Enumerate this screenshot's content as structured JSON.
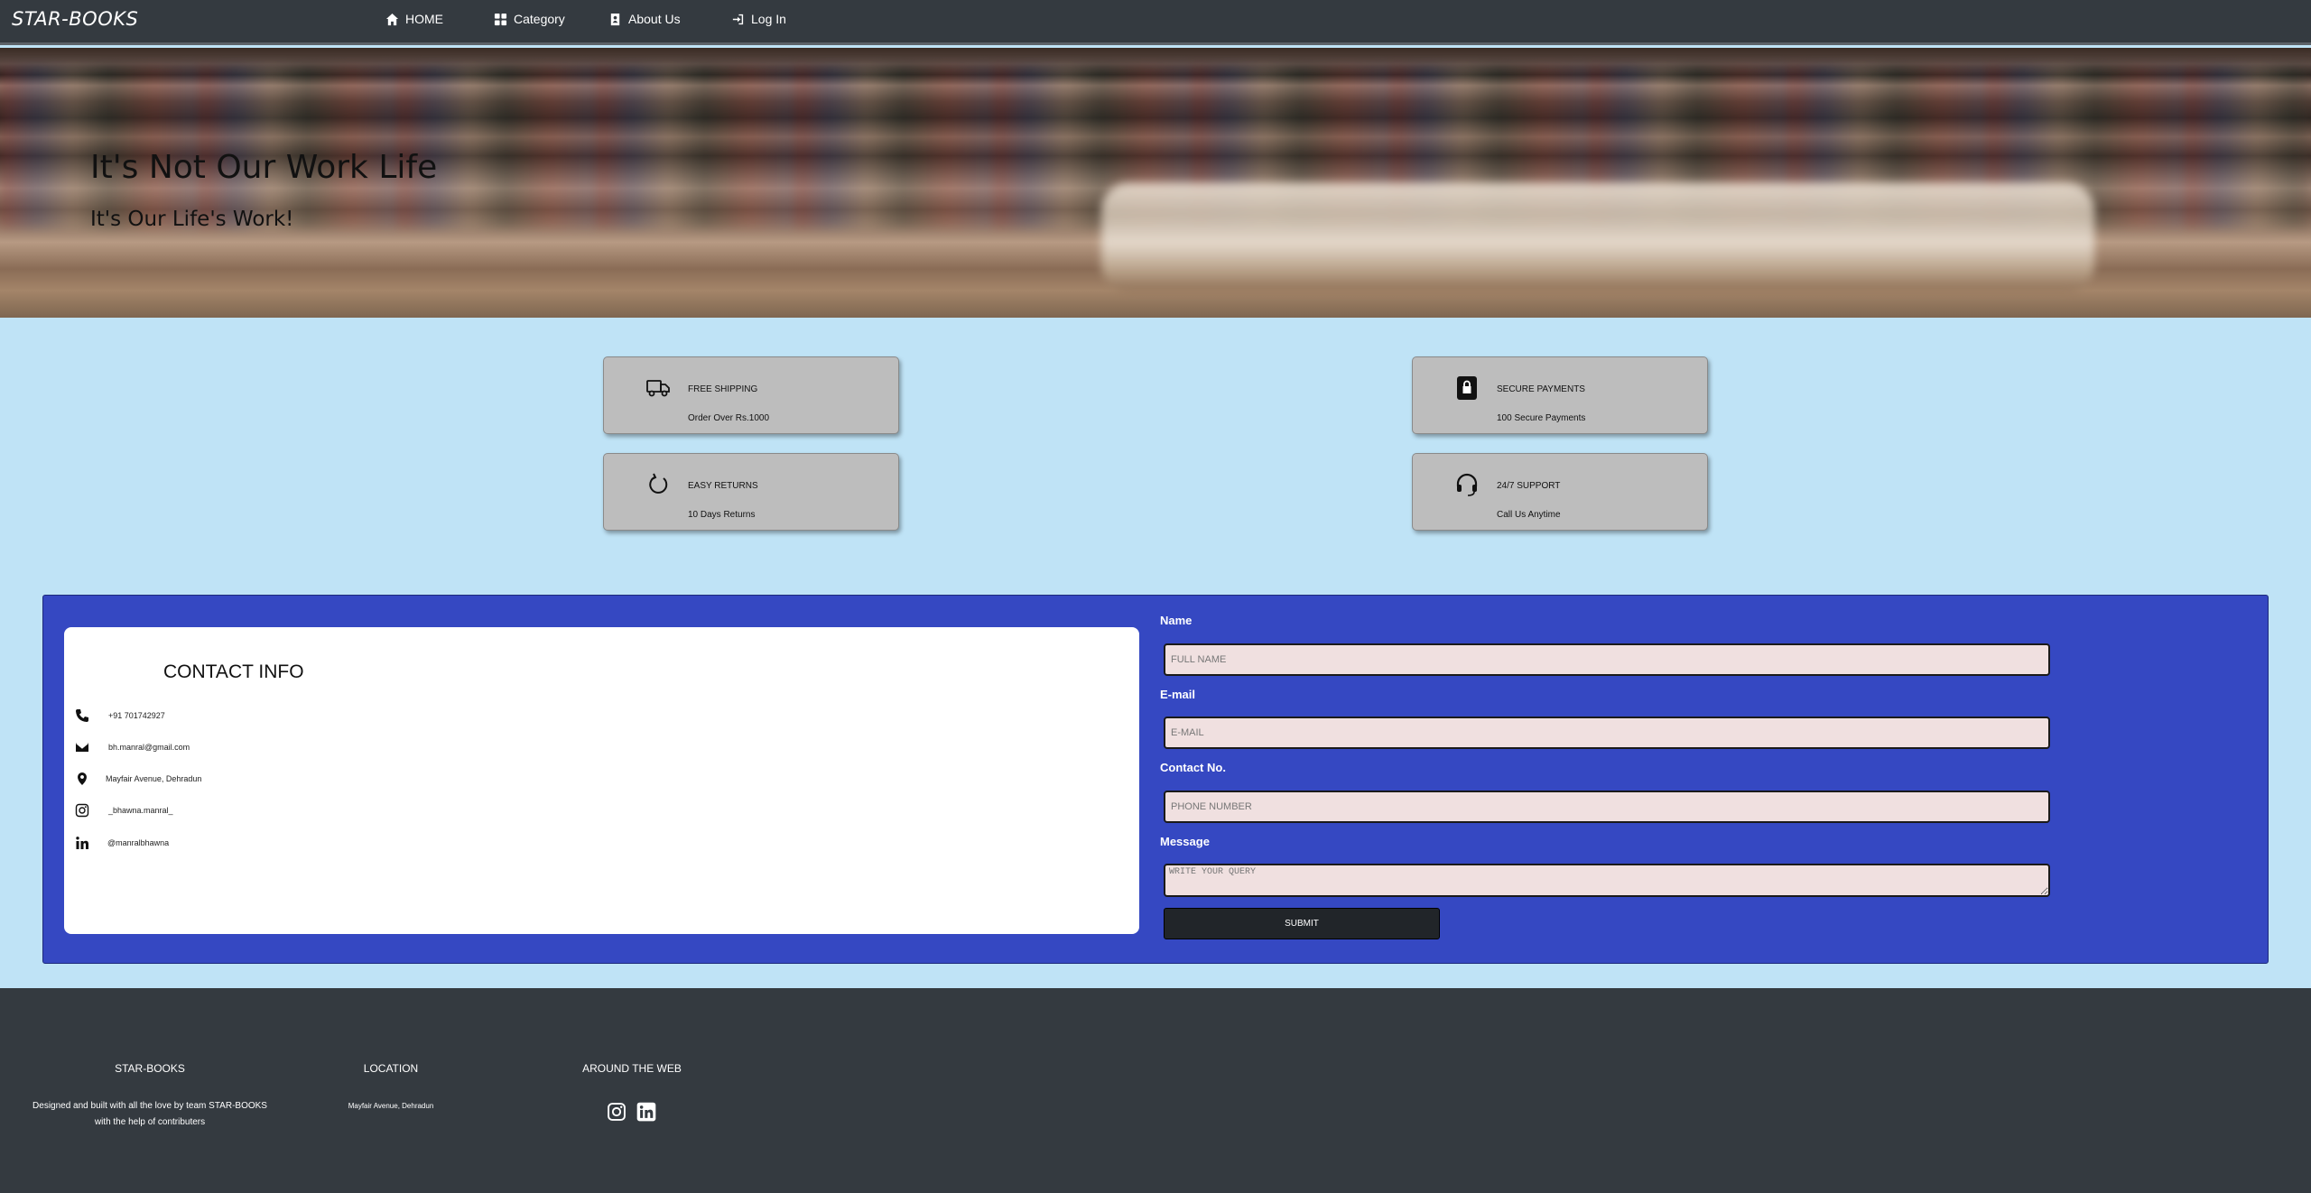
{
  "nav": {
    "brand": "STAR-BOOKS",
    "items": [
      {
        "label": "HOME",
        "icon": "home-icon"
      },
      {
        "label": "Category",
        "icon": "grid-icon"
      },
      {
        "label": "About Us",
        "icon": "contact-card-icon"
      },
      {
        "label": "Log In",
        "icon": "login-icon"
      }
    ]
  },
  "hero": {
    "title": "It's Not Our Work Life",
    "subtitle": "It's Our Life's Work!"
  },
  "features": [
    {
      "title": "FREE SHIPPING",
      "subtitle": "Order Over Rs.1000",
      "icon": "truck-icon"
    },
    {
      "title": "SECURE PAYMENTS",
      "subtitle": "100 Secure Payments",
      "icon": "lock-icon"
    },
    {
      "title": "EASY RETURNS",
      "subtitle": "10 Days Returns",
      "icon": "refresh-icon"
    },
    {
      "title": "24/7 SUPPORT",
      "subtitle": "Call Us Anytime",
      "icon": "headset-icon"
    }
  ],
  "contact_info": {
    "title": "CONTACT INFO",
    "items": [
      {
        "icon": "phone-icon",
        "text": "+91 701742927"
      },
      {
        "icon": "envelope-icon",
        "text": "bh.manral@gmail.com"
      },
      {
        "icon": "location-pin-icon",
        "text": "Mayfair Avenue, Dehradun"
      },
      {
        "icon": "instagram-icon",
        "text": "_bhawna.manral_"
      },
      {
        "icon": "linkedin-icon",
        "text": "@manralbhawna"
      }
    ]
  },
  "form": {
    "name_label": "Name",
    "name_placeholder": "FULL NAME",
    "email_label": "E-mail",
    "email_placeholder": "E-MAIL",
    "contact_label": "Contact No.",
    "contact_placeholder": "PHONE NUMBER",
    "message_label": "Message",
    "message_placeholder": "WRITE YOUR QUERY",
    "submit_label": "SUBMIT"
  },
  "footer": {
    "brand_title": "STAR-BOOKS",
    "brand_text_line1": "Designed and built with all the love by team STAR-BOOKS",
    "brand_text_line2": "with the help of contributers",
    "location_title": "LOCATION",
    "location_text": "Mayfair Avenue, Dehradun",
    "web_title": "AROUND THE WEB",
    "social": [
      "instagram-icon",
      "linkedin-icon"
    ]
  }
}
